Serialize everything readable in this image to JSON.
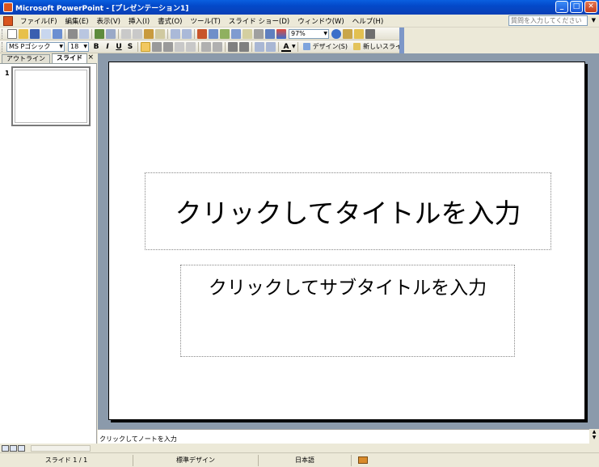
{
  "window": {
    "title": "Microsoft PowerPoint - [プレゼンテーション1]",
    "controls": [
      "minimize",
      "maximize",
      "close"
    ]
  },
  "menu": {
    "items": [
      "ファイル(F)",
      "編集(E)",
      "表示(V)",
      "挿入(I)",
      "書式(O)",
      "ツール(T)",
      "スライド ショー(D)",
      "ウィンドウ(W)",
      "ヘルプ(H)"
    ],
    "ask_placeholder": "質問を入力してください"
  },
  "standard_toolbar": {
    "zoom": "97%"
  },
  "formatting_toolbar": {
    "font_name": "MS Pゴシック",
    "font_size": "18",
    "bold": "B",
    "italic": "I",
    "underline": "U",
    "shadow": "S",
    "font_color_label": "A",
    "design_label": "デザイン(S)",
    "new_slide_label": "新しいスライド(N)"
  },
  "left_pane": {
    "tabs": [
      "アウトライン",
      "スライド"
    ],
    "active_tab": "スライド",
    "close": "×",
    "slide_number": "1"
  },
  "slide": {
    "title_placeholder": "クリックしてタイトルを入力",
    "subtitle_placeholder": "クリックしてサブタイトルを入力"
  },
  "notes": {
    "placeholder": "クリックしてノートを入力"
  },
  "status_bar": {
    "slide_position": "スライド 1 / 1",
    "design": "標準デザイン",
    "language": "日本語"
  }
}
